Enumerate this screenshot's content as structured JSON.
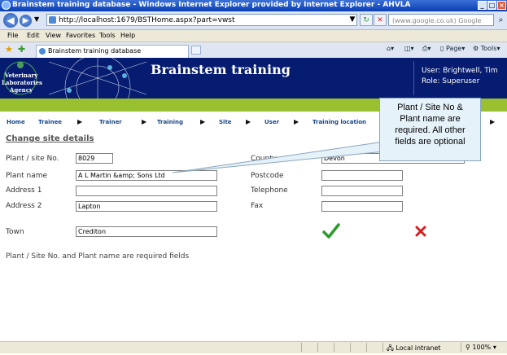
{
  "window": {
    "title": "Brainstem training database - Windows Internet Explorer provided by Internet Explorer - AHVLA"
  },
  "browser": {
    "address": "http://localhost:1679/BSTHome.aspx?part=vwst",
    "search_placeholder": "(www.google.co.uk) Google",
    "menu": [
      "File",
      "Edit",
      "View",
      "Favorites",
      "Tools",
      "Help"
    ],
    "tab_title": "Brainstem training database",
    "toolbar": {
      "page_label": "Page",
      "tools_label": "Tools"
    },
    "status": {
      "zone": "Local intranet",
      "zoom": "100%"
    }
  },
  "header": {
    "logo_text": [
      "Veterinary",
      "Laboratories",
      "Agency"
    ],
    "title": "Brainstem training",
    "user_line": "User: Brightwell, Tim",
    "role_line": "Role: Superuser"
  },
  "nav": [
    "Home",
    "Trainee",
    "Trainer",
    "Training",
    "Site",
    "User",
    "Training location"
  ],
  "page": {
    "section_title": "Change site details",
    "fields": {
      "plant_site_no": {
        "label": "Plant / site No.",
        "value": "8029"
      },
      "plant_name": {
        "label": "Plant name",
        "value": "A L Martin &amp; Sons Ltd"
      },
      "address1": {
        "label": "Address 1",
        "value": ""
      },
      "address2": {
        "label": "Address 2",
        "value": "Lapton"
      },
      "town": {
        "label": "Town",
        "value": "Crediton"
      },
      "county": {
        "label": "County",
        "value": "Devon"
      },
      "postcode": {
        "label": "Postcode",
        "value": ""
      },
      "telephone": {
        "label": "Telephone",
        "value": ""
      },
      "fax": {
        "label": "Fax",
        "value": ""
      }
    },
    "footnote": "Plant / Site No. and Plant name are required fields"
  },
  "callout": {
    "lines": [
      "Plant / Site No &",
      "Plant name are",
      "required. All other",
      "fields are optional"
    ]
  },
  "colors": {
    "header_bg": "#061c70",
    "accent_green": "#99c12f",
    "nav_text": "#16468a",
    "confirm": "#2a9a2a",
    "cancel": "#d62020"
  }
}
